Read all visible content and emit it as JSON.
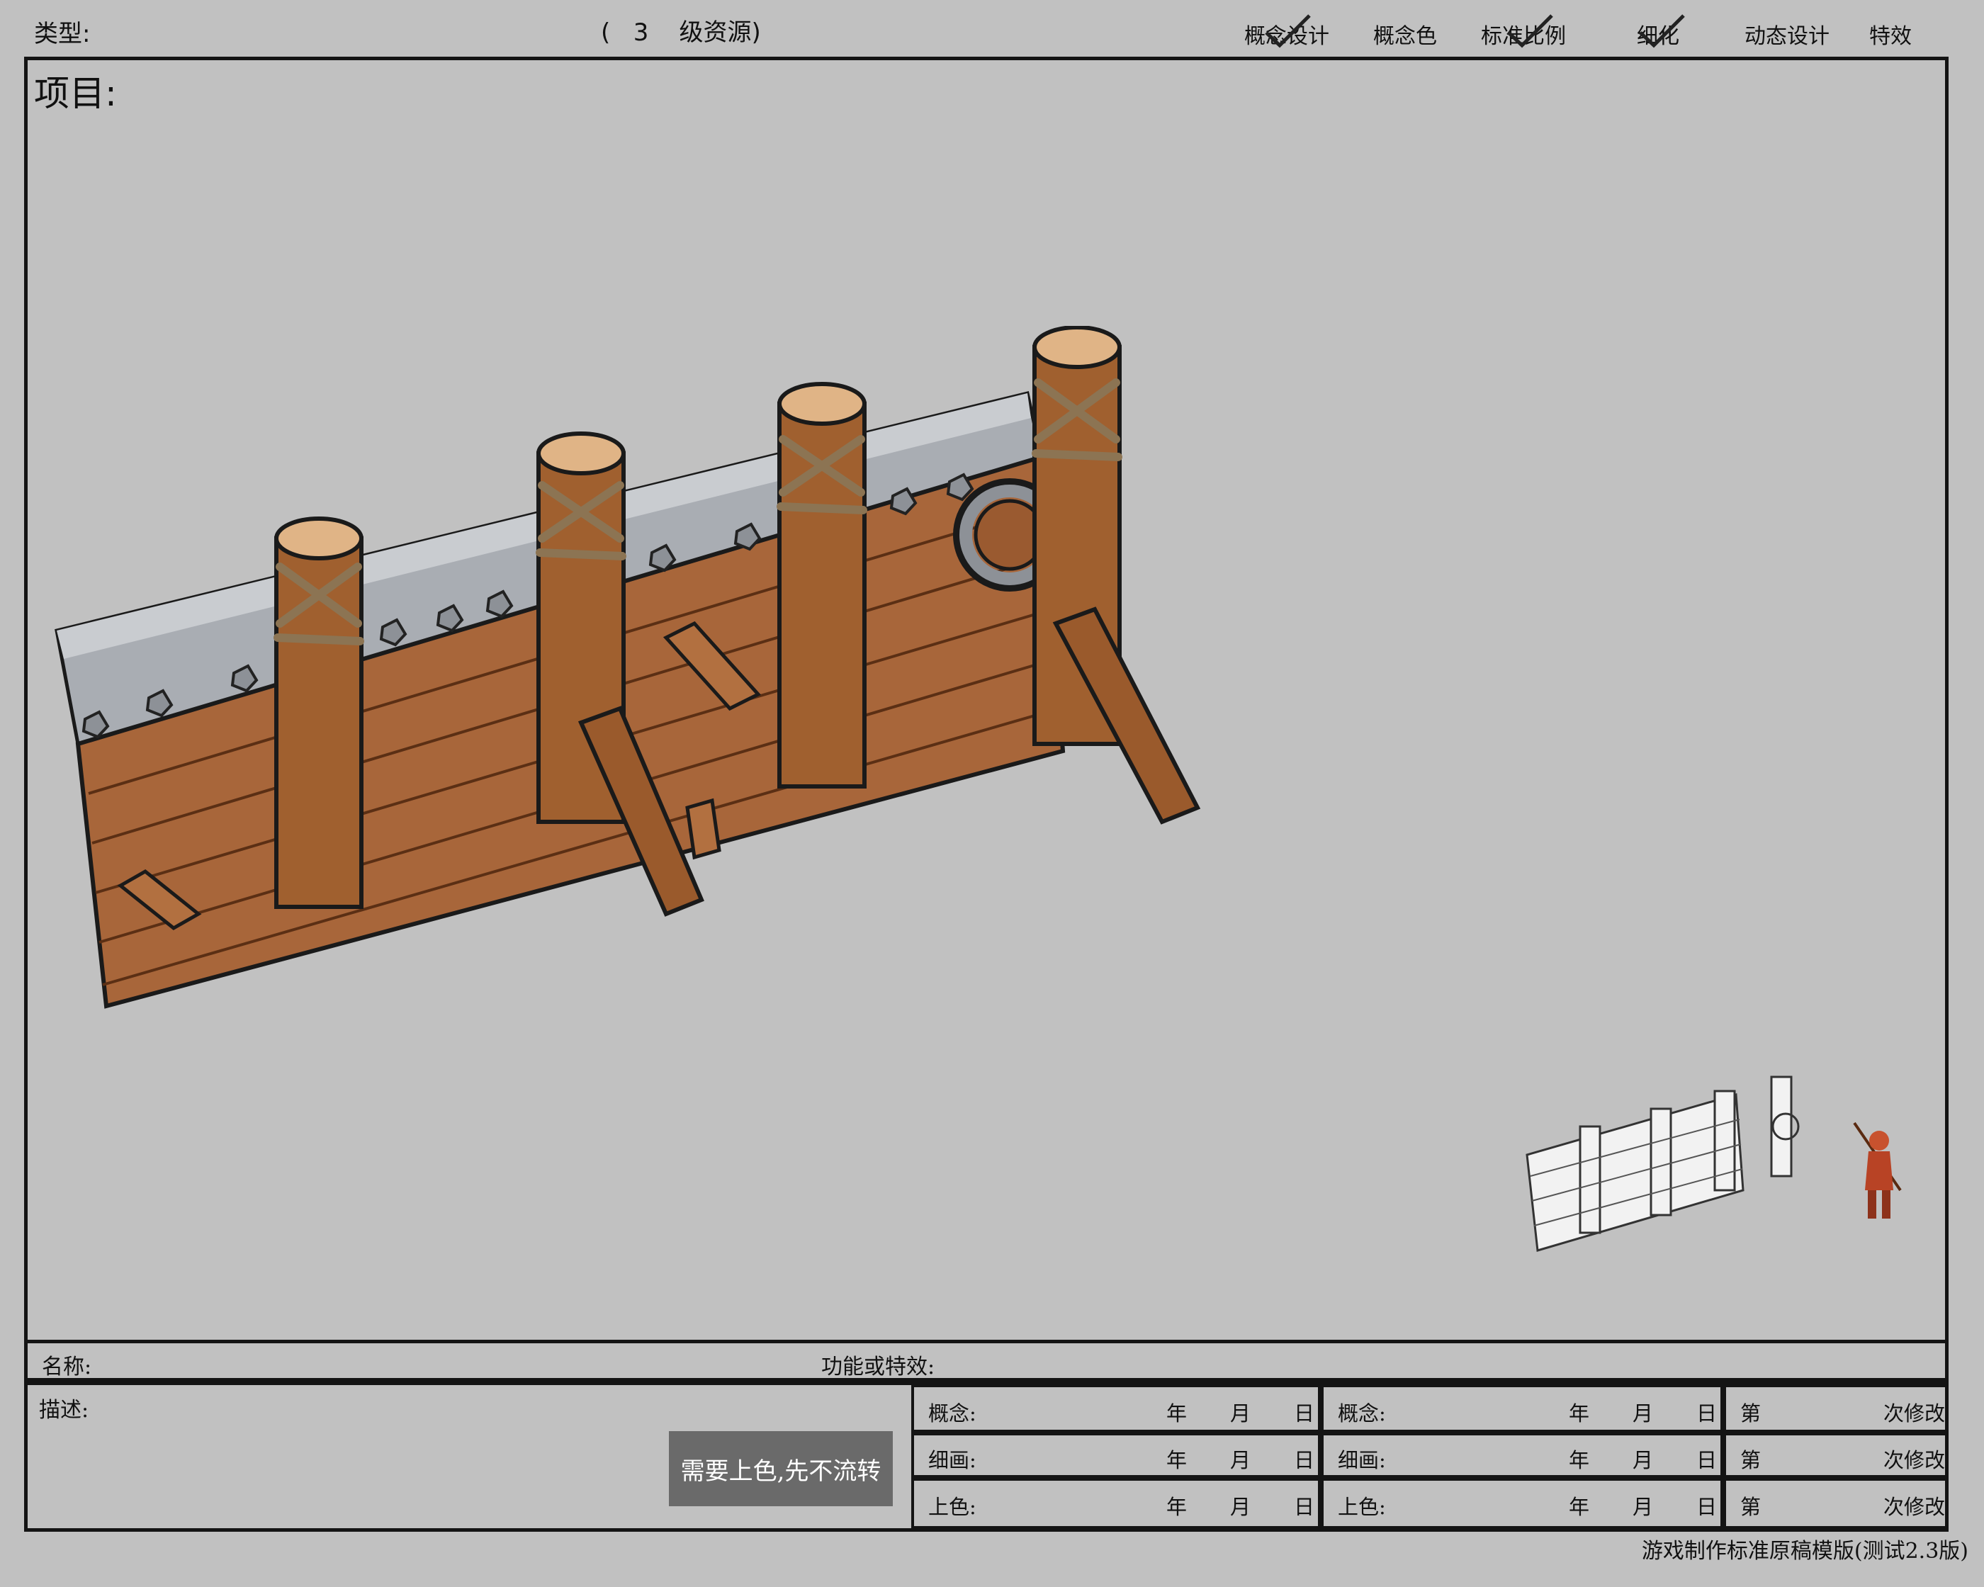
{
  "header": {
    "type_label": "类型:",
    "level_text": "(   3    级资源)",
    "stages": [
      "概念设计",
      "概念色",
      "标准比例",
      "细化",
      "动态设计",
      "特效"
    ]
  },
  "project_label": "项目:",
  "form": {
    "name_label": "名称:",
    "function_label": "功能或特效:",
    "desc_label": "描述:",
    "note": "需要上色,先不流转",
    "date_rows": [
      {
        "label": "概念:",
        "year": "年",
        "month": "月",
        "day": "日"
      },
      {
        "label": "细画:",
        "year": "年",
        "month": "月",
        "day": "日"
      },
      {
        "label": "上色:",
        "year": "年",
        "month": "月",
        "day": "日"
      }
    ],
    "revision_rows": [
      {
        "prefix": "第",
        "suffix": "次修改"
      },
      {
        "prefix": "第",
        "suffix": "次修改"
      },
      {
        "prefix": "第",
        "suffix": "次修改"
      }
    ]
  },
  "footer": "游戏制作标准原稿模版(测试2.3版)",
  "colors": {
    "background": "#c1c1c1",
    "wood": "#a8663a",
    "wood_dark": "#6e3d1e",
    "metal": "#a9adb3",
    "rope": "#8c7453",
    "note_bg": "#6a6a6a"
  }
}
